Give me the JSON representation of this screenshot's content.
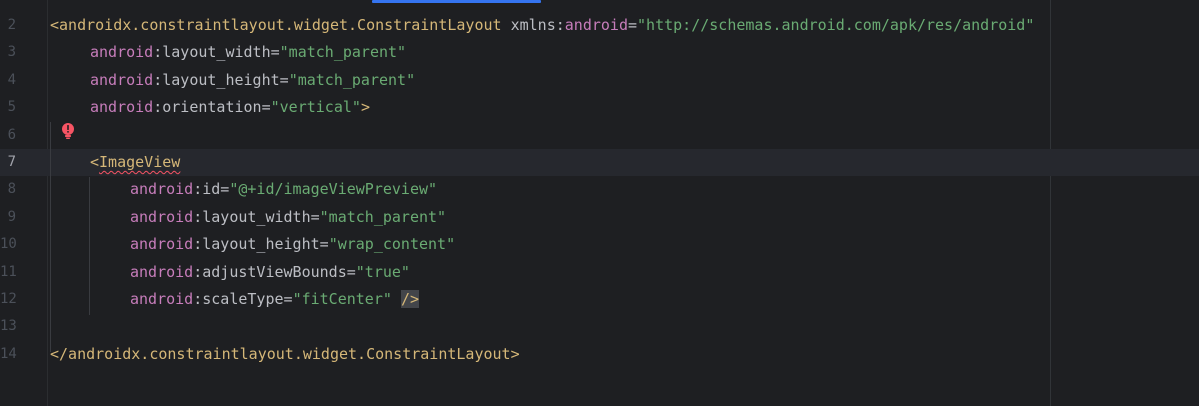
{
  "editor": {
    "lines": [
      {
        "number": "2",
        "indent": 0,
        "tokens": [
          {
            "t": "<androidx.constraintlayout.widget.ConstraintLayout",
            "c": "tag"
          },
          {
            "t": " xmlns:",
            "c": "attr"
          },
          {
            "t": "android",
            "c": "ns"
          },
          {
            "t": "=",
            "c": "attr"
          },
          {
            "t": "\"http://schemas.android.com/apk/res/android\"",
            "c": "val"
          }
        ]
      },
      {
        "number": "3",
        "indent": 1,
        "tokens": [
          {
            "t": "android",
            "c": "ns"
          },
          {
            "t": ":layout_width=",
            "c": "attr"
          },
          {
            "t": "\"match_parent\"",
            "c": "val"
          }
        ]
      },
      {
        "number": "4",
        "indent": 1,
        "tokens": [
          {
            "t": "android",
            "c": "ns"
          },
          {
            "t": ":layout_height=",
            "c": "attr"
          },
          {
            "t": "\"match_parent\"",
            "c": "val"
          }
        ]
      },
      {
        "number": "5",
        "indent": 1,
        "tokens": [
          {
            "t": "android",
            "c": "ns"
          },
          {
            "t": ":orientation=",
            "c": "attr"
          },
          {
            "t": "\"vertical\"",
            "c": "val"
          },
          {
            "t": ">",
            "c": "tag"
          }
        ]
      },
      {
        "number": "6",
        "indent": 0,
        "tokens": []
      },
      {
        "number": "7",
        "indent": 1,
        "current": true,
        "tokens": [
          {
            "t": "<",
            "c": "tag"
          },
          {
            "t": "ImageView",
            "c": "tag err-underline"
          }
        ]
      },
      {
        "number": "8",
        "indent": 2,
        "tokens": [
          {
            "t": "android",
            "c": "ns"
          },
          {
            "t": ":id=",
            "c": "attr"
          },
          {
            "t": "\"@+id/imageViewPreview\"",
            "c": "val"
          }
        ]
      },
      {
        "number": "9",
        "indent": 2,
        "tokens": [
          {
            "t": "android",
            "c": "ns"
          },
          {
            "t": ":layout_width=",
            "c": "attr"
          },
          {
            "t": "\"match_parent\"",
            "c": "val"
          }
        ]
      },
      {
        "number": "10",
        "indent": 2,
        "tokens": [
          {
            "t": "android",
            "c": "ns"
          },
          {
            "t": ":layout_height=",
            "c": "attr"
          },
          {
            "t": "\"wrap_content\"",
            "c": "val"
          }
        ]
      },
      {
        "number": "11",
        "indent": 2,
        "tokens": [
          {
            "t": "android",
            "c": "ns"
          },
          {
            "t": ":adjustViewBounds=",
            "c": "attr"
          },
          {
            "t": "\"true\"",
            "c": "val"
          }
        ]
      },
      {
        "number": "12",
        "indent": 2,
        "tokens": [
          {
            "t": "android",
            "c": "ns"
          },
          {
            "t": ":scaleType=",
            "c": "attr"
          },
          {
            "t": "\"fitCenter\"",
            "c": "val"
          },
          {
            "t": " ",
            "c": "attr"
          },
          {
            "t": "/>",
            "c": "tag sel-close"
          }
        ]
      },
      {
        "number": "13",
        "indent": 0,
        "tokens": []
      },
      {
        "number": "14",
        "indent": 0,
        "tokens": [
          {
            "t": "</androidx.constraintlayout.widget.ConstraintLayout>",
            "c": "tag"
          }
        ]
      }
    ]
  },
  "gutter": {
    "error_icon": "error-bulb-icon"
  },
  "colors": {
    "background": "#1e1f22",
    "tag": "#d5b778",
    "namespace": "#c77dbb",
    "attribute": "#bcbec4",
    "value": "#6aab73",
    "error": "#f75464",
    "current_line": "#26282e"
  }
}
